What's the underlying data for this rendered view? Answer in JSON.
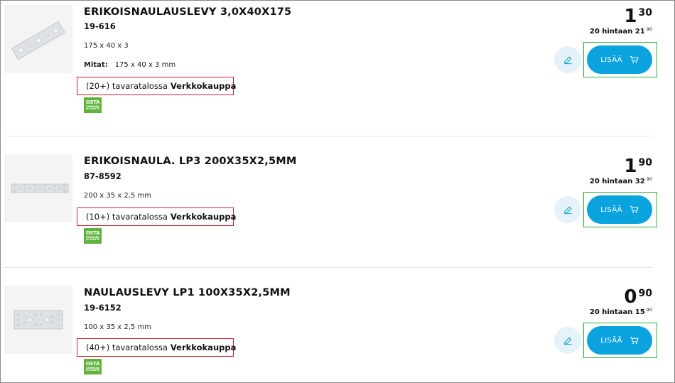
{
  "products": [
    {
      "title": "ERIKOISNAULAUSLEVY 3,0X40X175",
      "sku": "19-616",
      "dims": "175 x 40 x 3",
      "mitat_label": "Mitat:",
      "mitat_value": "175 x 40 x 3 mm",
      "stock_count": "(20+) tavaratalossa",
      "stock_location": "Verkkokauppa",
      "badge": {
        "line1": "OSTA",
        "line2": "ENEMMÄN",
        "line3": "JA SÄÄSTÄ"
      },
      "price_int": "1",
      "price_dec": "30",
      "bulk_text": "20 hintaan 21",
      "bulk_dec": "90",
      "add_label": "LISÄÄ"
    },
    {
      "title": "ERIKOISNAULA. LP3 200X35X2,5MM",
      "sku": "87-8592",
      "dims": "200 x 35 x 2,5 mm",
      "stock_count": "(10+) tavaratalossa",
      "stock_location": "Verkkokauppa",
      "badge": {
        "line1": "OSTA",
        "line2": "ENEMMÄN",
        "line3": "JA SÄÄSTÄ"
      },
      "price_int": "1",
      "price_dec": "90",
      "bulk_text": "20 hintaan 32",
      "bulk_dec": "90",
      "add_label": "LISÄÄ"
    },
    {
      "title": "NAULAUSLEVY LP1 100X35X2,5MM",
      "sku": "19-6152",
      "dims": "100 x 35 x 2,5 mm",
      "stock_count": "(40+) tavaratalossa",
      "stock_location": "Verkkokauppa",
      "badge": {
        "line1": "OSTA",
        "line2": "ENEMMÄN",
        "line3": "JA SÄÄSTÄ"
      },
      "price_int": "0",
      "price_dec": "90",
      "bulk_text": "20 hintaan 15",
      "bulk_dec": "90",
      "add_label": "LISÄÄ"
    }
  ],
  "colors": {
    "accent": "#0aa3dd",
    "edit_bg": "#e6f2f9",
    "stock_outline": "#cc1f2f",
    "add_outline": "#2eae3a",
    "badge_green": "#5fb33a"
  },
  "icons": {
    "check": "check-circle-icon",
    "edit": "edit-icon",
    "cart": "cart-icon"
  }
}
